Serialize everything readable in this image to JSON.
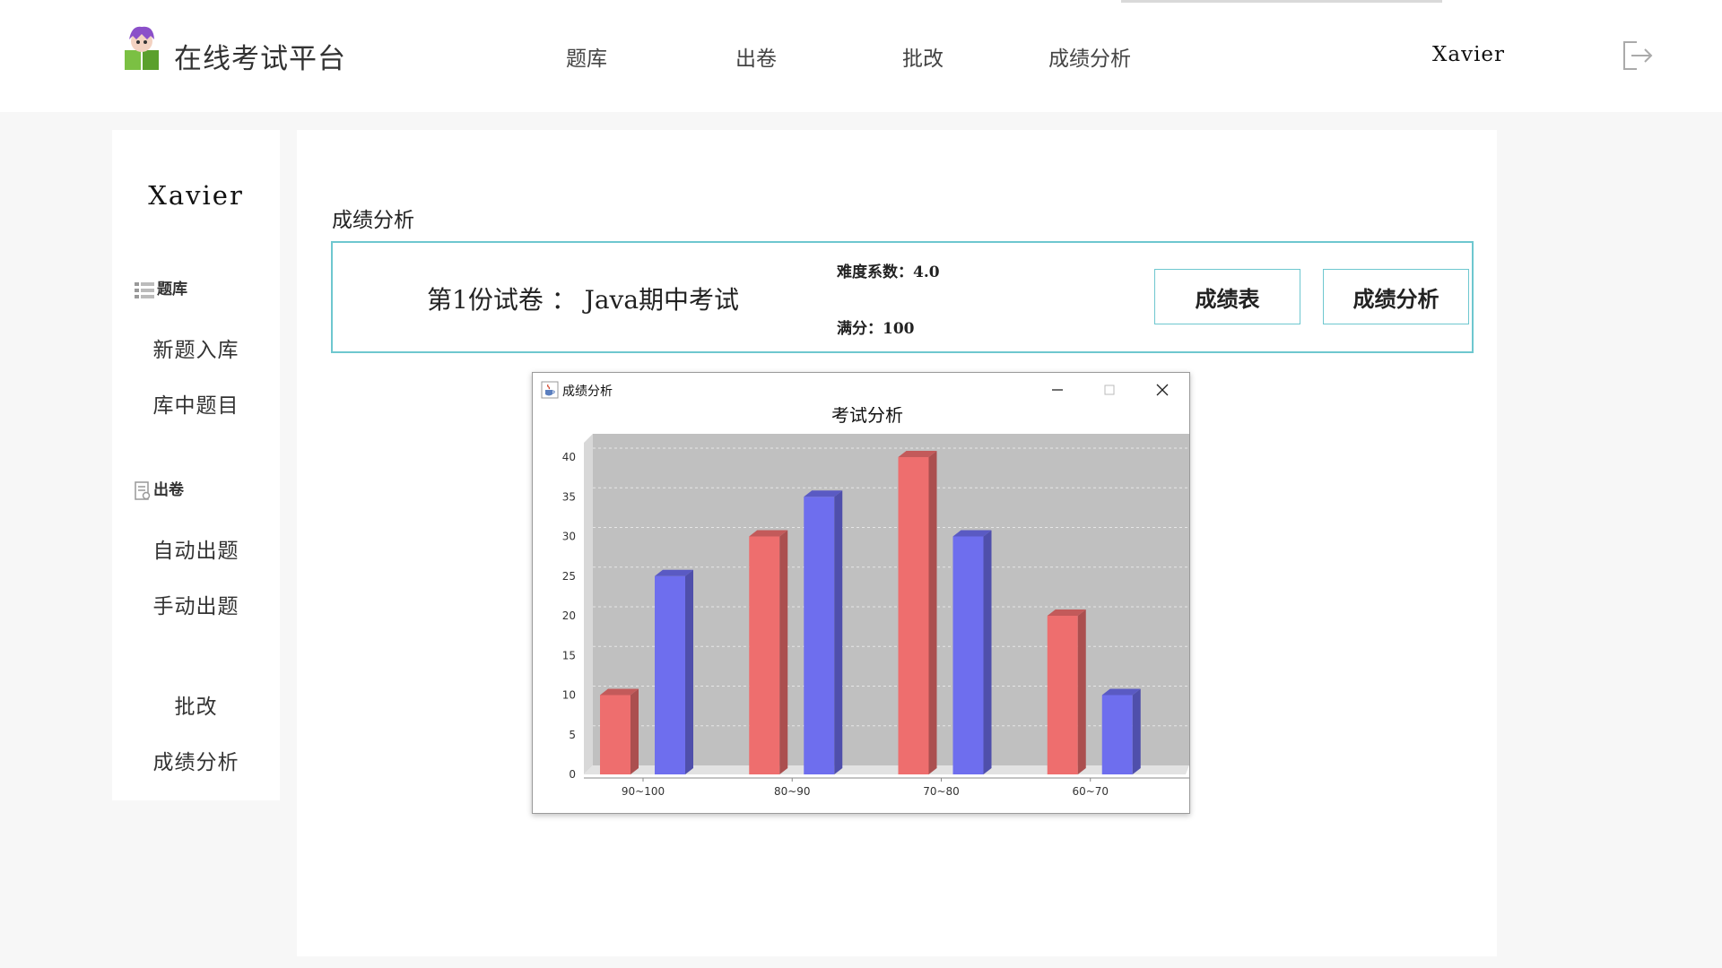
{
  "app": {
    "title": "在线考试平台"
  },
  "nav": {
    "items": [
      "题库",
      "出卷",
      "批改",
      "成绩分析"
    ]
  },
  "user": {
    "name": "Xavier"
  },
  "sidebar": {
    "user_name": "Xavier",
    "groups": [
      {
        "label": "题库",
        "icon": "list-icon",
        "items": [
          "新题入库",
          "库中题目"
        ]
      },
      {
        "label": "出卷",
        "icon": "document-icon",
        "items": [
          "自动出题",
          "手动出题"
        ]
      }
    ],
    "extra_items": [
      "批改",
      "成绩分析"
    ]
  },
  "main": {
    "section_title": "成绩分析",
    "paper": {
      "name": "第1份试卷 ： Java期中考试",
      "difficulty": "难度系数：4.0",
      "full_score": "满分：100"
    },
    "buttons": {
      "score_table": "成绩表",
      "score_analysis": "成绩分析"
    }
  },
  "dialog": {
    "title": "成绩分析",
    "icon": "java-cup-icon",
    "controls": [
      "minimize-icon",
      "maximize-icon",
      "close-icon"
    ]
  },
  "chart_data": {
    "type": "bar",
    "title": "考试分析",
    "ylabel": "",
    "ylim": [
      0,
      40
    ],
    "yticks": [
      0,
      5,
      10,
      15,
      20,
      25,
      30,
      35,
      40
    ],
    "ytick_labels": [
      "0",
      "5",
      "10",
      "15",
      "20",
      "25",
      "30",
      "35",
      "40"
    ],
    "categories": [
      "90-100",
      "80-90",
      "70-80",
      "60-70"
    ],
    "category_labels": [
      "90~100",
      "80~90",
      "70~80",
      "60~70"
    ],
    "series": [
      {
        "values": [
          10,
          30,
          40,
          20
        ],
        "color": "#ee6e6e"
      },
      {
        "values": [
          25,
          35,
          30,
          10
        ],
        "color": "#6e6eee"
      }
    ],
    "grid": true,
    "style": "3d",
    "background": "#c0c0c0"
  },
  "colors": {
    "accent": "#6ec7cf",
    "red_bar": "#ee6e6e",
    "blue_bar": "#6e6eee"
  }
}
